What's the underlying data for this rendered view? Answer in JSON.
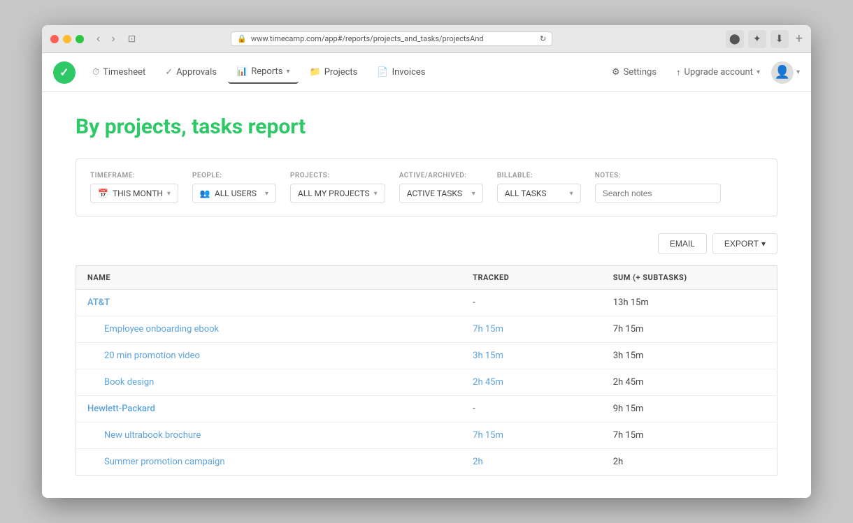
{
  "window": {
    "url": "www.timecamp.com/app#/reports/projects_and_tasks/projectsAnd"
  },
  "navbar": {
    "logo_alt": "TimeCamp logo",
    "items": [
      {
        "id": "timesheet",
        "icon": "⏱",
        "label": "Timesheet",
        "active": false
      },
      {
        "id": "approvals",
        "icon": "✓",
        "label": "Approvals",
        "active": false
      },
      {
        "id": "reports",
        "icon": "📊",
        "label": "Reports",
        "active": true,
        "dropdown": true
      },
      {
        "id": "projects",
        "icon": "📁",
        "label": "Projects",
        "active": false
      },
      {
        "id": "invoices",
        "icon": "📄",
        "label": "Invoices",
        "active": false
      }
    ],
    "right_items": [
      {
        "id": "settings",
        "icon": "⚙",
        "label": "Settings"
      },
      {
        "id": "upgrade",
        "icon": "↑",
        "label": "Upgrade account",
        "dropdown": true
      }
    ]
  },
  "page": {
    "title": "By projects, tasks report"
  },
  "filters": {
    "timeframe": {
      "label": "TIMEFRAME:",
      "value": "THIS MONTH",
      "icon": "📅"
    },
    "people": {
      "label": "PEOPLE:",
      "value": "ALL USERS",
      "icon": "👥"
    },
    "projects": {
      "label": "PROJECTS:",
      "value": "ALL MY PROJECTS"
    },
    "active_archived": {
      "label": "ACTIVE/ARCHIVED:",
      "value": "ACTIVE TASKS"
    },
    "billable": {
      "label": "BILLABLE:",
      "value": "ALL TASKS"
    },
    "notes": {
      "label": "NOTES:",
      "placeholder": "Search notes"
    }
  },
  "actions": {
    "email_label": "EMAIL",
    "export_label": "EXPORT"
  },
  "table": {
    "columns": [
      {
        "id": "name",
        "label": "NAME"
      },
      {
        "id": "tracked",
        "label": "TRACKED"
      },
      {
        "id": "sum",
        "label": "SUM (+ SUBTASKS)"
      }
    ],
    "rows": [
      {
        "id": "att",
        "type": "project",
        "name": "AT&T",
        "tracked": "-",
        "sum": "13h 15m",
        "children": [
          {
            "id": "att-1",
            "type": "task",
            "name": "Employee onboarding ebook",
            "tracked": "7h 15m",
            "sum": "7h 15m"
          },
          {
            "id": "att-2",
            "type": "task",
            "name": "20 min promotion video",
            "tracked": "3h 15m",
            "sum": "3h 15m"
          },
          {
            "id": "att-3",
            "type": "task",
            "name": "Book design",
            "tracked": "2h 45m",
            "sum": "2h 45m"
          }
        ]
      },
      {
        "id": "hp",
        "type": "project",
        "name": "Hewlett-Packard",
        "tracked": "-",
        "sum": "9h 15m",
        "children": [
          {
            "id": "hp-1",
            "type": "task",
            "name": "New ultrabook brochure",
            "tracked": "7h 15m",
            "sum": "7h 15m"
          },
          {
            "id": "hp-2",
            "type": "task",
            "name": "Summer promotion campaign",
            "tracked": "2h",
            "sum": "2h"
          }
        ]
      }
    ]
  }
}
